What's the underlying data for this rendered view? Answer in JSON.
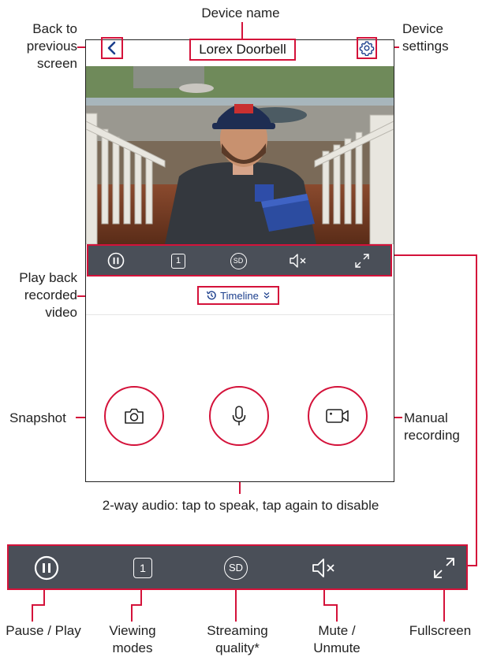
{
  "app": {
    "device_name": "Lorex Doorbell",
    "timeline_label": "Timeline"
  },
  "annotations": {
    "back": [
      "Back to",
      "previous",
      "screen"
    ],
    "device_name": "Device name",
    "settings": [
      "Device",
      "settings"
    ],
    "playback": [
      "Play back",
      "recorded",
      "video"
    ],
    "snapshot": "Snapshot",
    "manual_recording": [
      "Manual",
      "recording"
    ],
    "two_way_audio": "2-way audio: tap to speak, tap again to disable",
    "pause_play": "Pause / Play",
    "viewing_modes": [
      "Viewing",
      "modes"
    ],
    "streaming_quality": [
      "Streaming",
      "quality*"
    ],
    "mute": [
      "Mute /",
      "Unmute"
    ],
    "fullscreen": "Fullscreen"
  },
  "controls": {
    "viewing_mode_value": "1",
    "quality_value": "SD"
  },
  "icons": [
    "back-chevron-icon",
    "settings-gear-icon",
    "pause-icon",
    "viewing-mode-icon",
    "sd-quality-icon",
    "mute-icon",
    "fullscreen-icon",
    "history-icon",
    "chevron-double-down-icon",
    "camera-icon",
    "microphone-icon",
    "video-record-icon"
  ],
  "colors": {
    "annotation_red": "#d4123a",
    "toolbar_bg": "#4a4f58",
    "link_blue": "#1b3e8c"
  }
}
